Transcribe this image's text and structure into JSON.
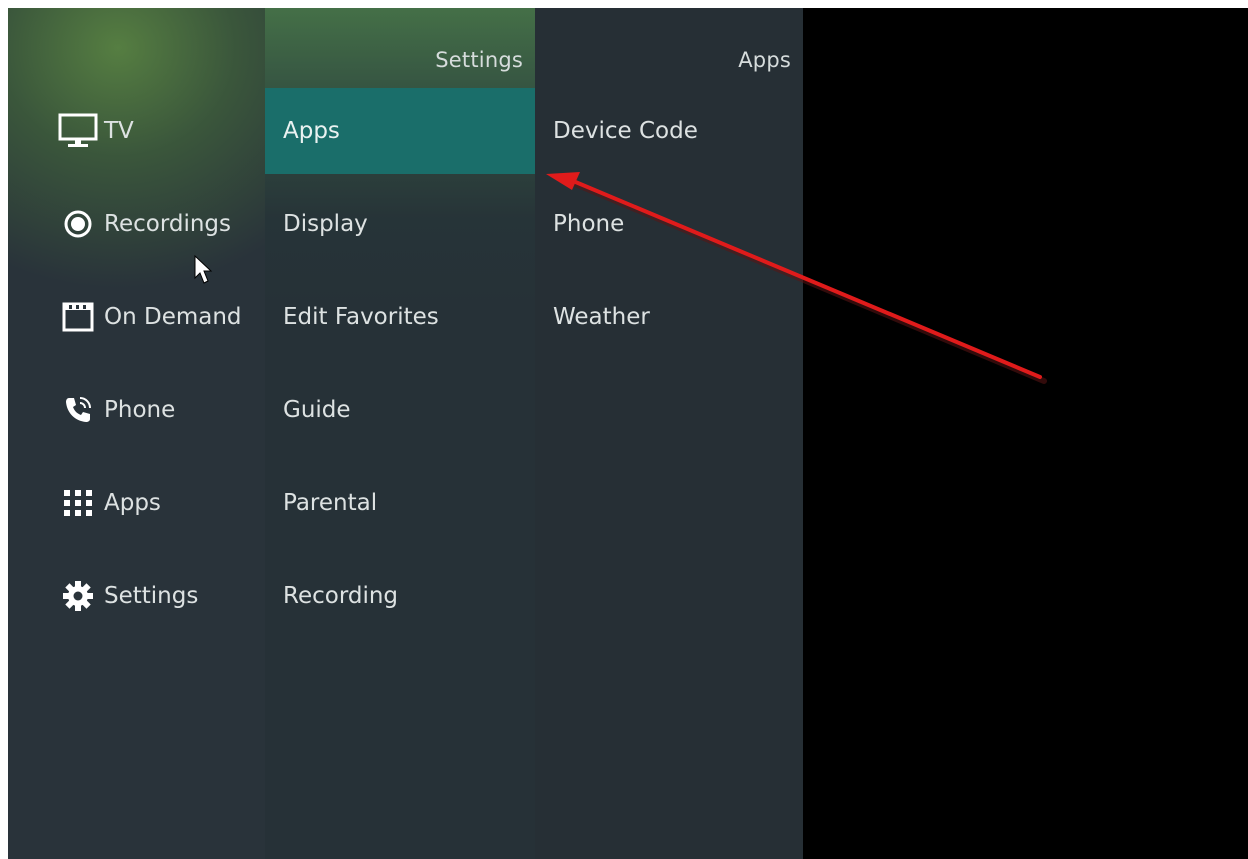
{
  "sidebar": {
    "items": [
      {
        "label": "TV",
        "icon": "tv-icon"
      },
      {
        "label": "Recordings",
        "icon": "record-icon"
      },
      {
        "label": "On Demand",
        "icon": "calendar-icon"
      },
      {
        "label": "Phone",
        "icon": "phone-icon"
      },
      {
        "label": "Apps",
        "icon": "grid-icon"
      },
      {
        "label": "Settings",
        "icon": "gear-icon"
      }
    ]
  },
  "settings_menu": {
    "title": "Settings",
    "items": [
      {
        "label": "Apps",
        "selected": true
      },
      {
        "label": "Display"
      },
      {
        "label": "Edit Favorites"
      },
      {
        "label": "Guide"
      },
      {
        "label": "Parental"
      },
      {
        "label": "Recording"
      }
    ]
  },
  "apps_menu": {
    "title": "Apps",
    "items": [
      {
        "label": "Device Code"
      },
      {
        "label": "Phone"
      },
      {
        "label": "Weather"
      }
    ]
  },
  "colors": {
    "selected": "#1a6e6a",
    "annotation_arrow": "#e01b1b",
    "text": "#dde2e2",
    "panel": "#262f35"
  },
  "annotations": {
    "arrow_icon": "red-arrow-annotation",
    "cursor_icon": "mouse-pointer-icon"
  }
}
